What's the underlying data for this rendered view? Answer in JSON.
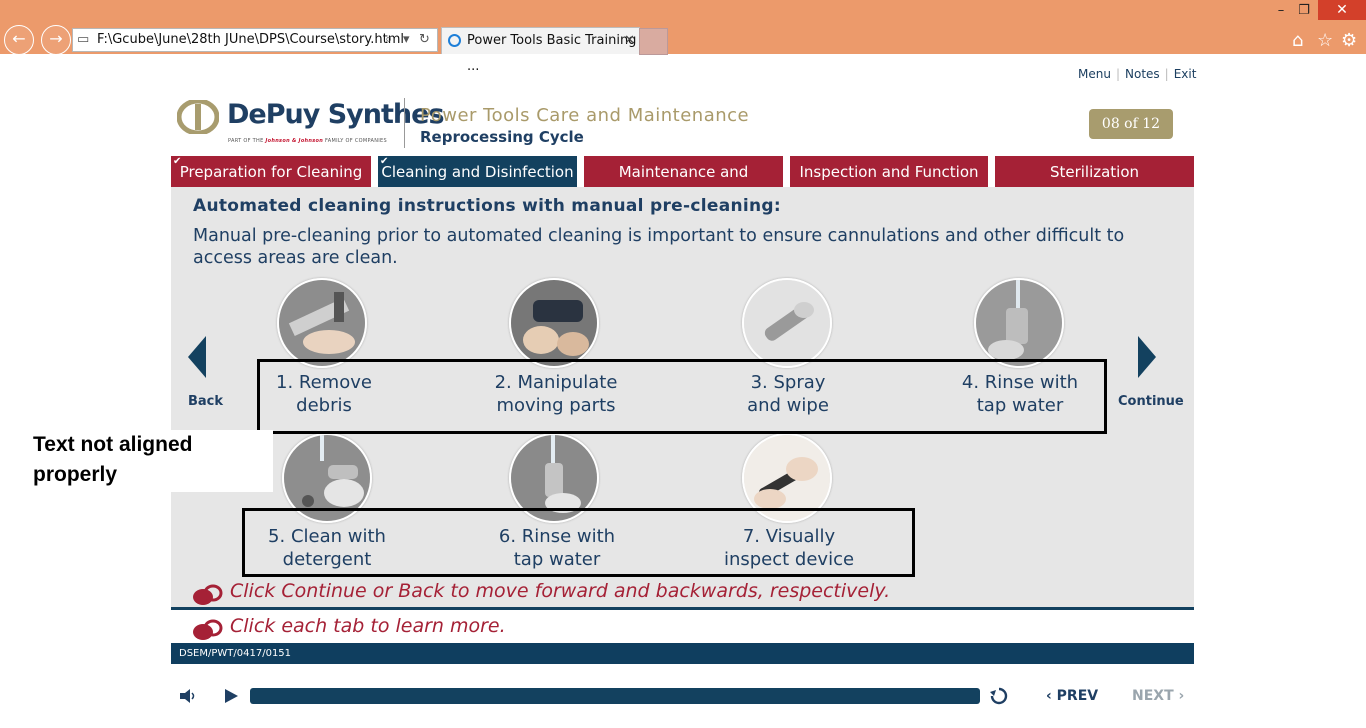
{
  "browser": {
    "address": "F:\\Gcube\\June\\28th JUne\\DPS\\Course\\story.html",
    "tab_title": "Power Tools Basic Training ...",
    "back_glyph": "←",
    "forward_glyph": "→",
    "close_tab_glyph": "✕"
  },
  "top_links": {
    "menu": "Menu",
    "notes": "Notes",
    "exit": "Exit"
  },
  "brand": {
    "logo_text": "DePuy Synthes",
    "logo_sub_prefix": "PART OF THE",
    "logo_sub_brand": "Johnson & Johnson",
    "logo_sub_suffix": "FAMILY OF COMPANIES"
  },
  "course": {
    "title": "Power Tools Care and Maintenance",
    "subtitle": "Reprocessing Cycle"
  },
  "page_counter": "08 of 12",
  "tabs": [
    {
      "label": "Preparation for Cleaning",
      "visited": true
    },
    {
      "label": "Cleaning and Disinfection",
      "visited": true,
      "active": true
    },
    {
      "label": "Maintenance and Lubrication"
    },
    {
      "label": "Inspection and Function Test"
    },
    {
      "label": "Sterilization"
    }
  ],
  "content": {
    "heading": "Automated cleaning instructions with manual pre-cleaning:",
    "intro": "Manual pre-cleaning prior to automated cleaning is important to ensure cannulations and other difficult to access areas are clean.",
    "steps": [
      {
        "line1": "1. Remove",
        "line2": "debris"
      },
      {
        "line1": "2. Manipulate",
        "line2": "moving parts"
      },
      {
        "line1": "3. Spray",
        "line2": "and wipe"
      },
      {
        "line1": "4. Rinse with",
        "line2": "tap water"
      },
      {
        "line1": "5. Clean with",
        "line2": "detergent"
      },
      {
        "line1": "6. Rinse with",
        "line2": "tap water"
      },
      {
        "line1": "7. Visually",
        "line2": "inspect device"
      }
    ],
    "back_label": "Back",
    "continue_label": "Continue"
  },
  "annotation": {
    "line1": "Text not aligned",
    "line2": "properly"
  },
  "instructions": {
    "nav": "Click Continue or Back to move forward and backwards, respectively.",
    "tabs": "Click each tab to learn more."
  },
  "footer_code": "DSEM/PWT/0417/0151",
  "player": {
    "prev": "PREV",
    "next": "NEXT"
  },
  "colors": {
    "brand_red": "#a52136",
    "brand_navy": "#13415f",
    "gold": "#a89c6e",
    "chrome": "#ec9a6b"
  }
}
